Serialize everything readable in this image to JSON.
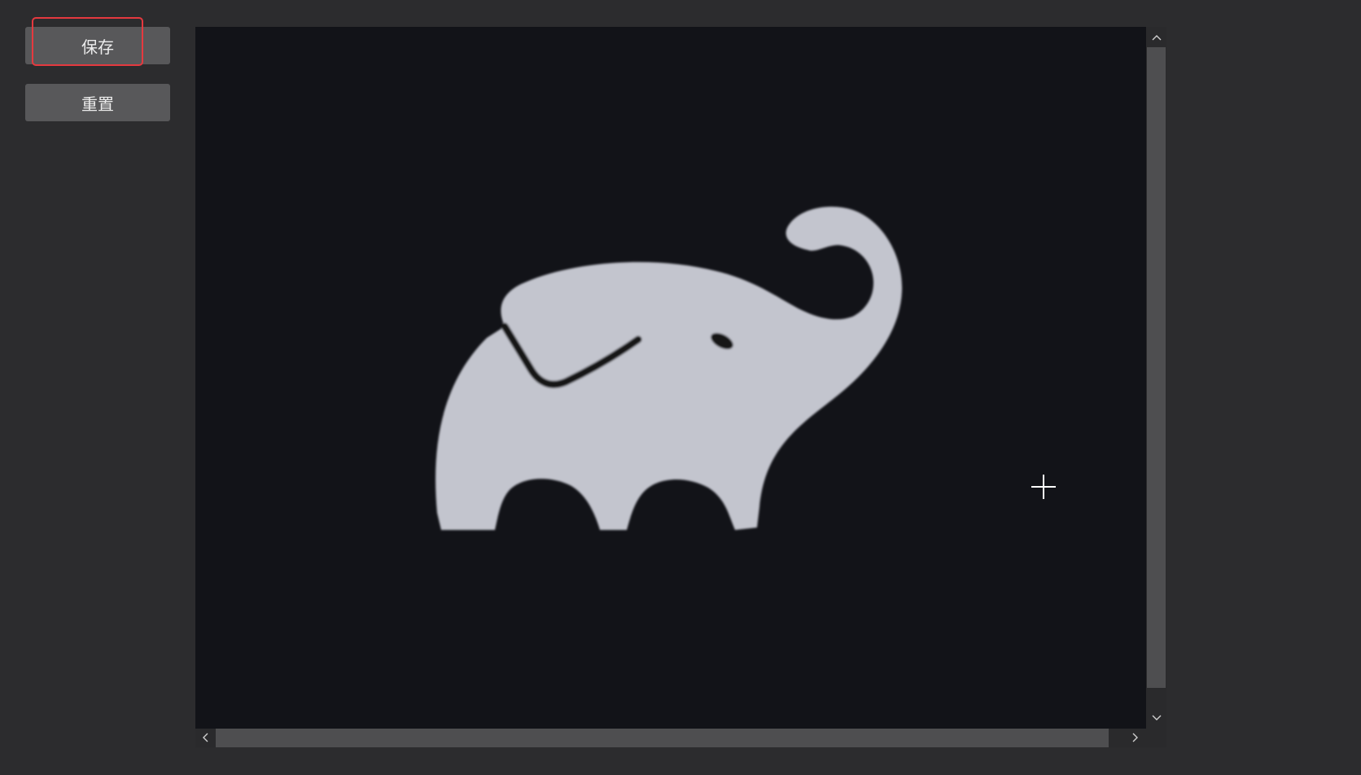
{
  "toolbar": {
    "save_label": "保存",
    "reset_label": "重置"
  },
  "canvas": {
    "image_icon": "elephant-icon",
    "cursor_icon": "crosshair-icon"
  },
  "scrollbars": {
    "vertical_up_icon": "chevron-up-icon",
    "vertical_down_icon": "chevron-down-icon",
    "horizontal_left_icon": "chevron-left-icon",
    "horizontal_right_icon": "chevron-right-icon"
  },
  "colors": {
    "background": "#2c2c2e",
    "button": "#58585a",
    "highlight": "#e5393f",
    "canvas": "#121318",
    "elephant": "#c3c5ce"
  }
}
